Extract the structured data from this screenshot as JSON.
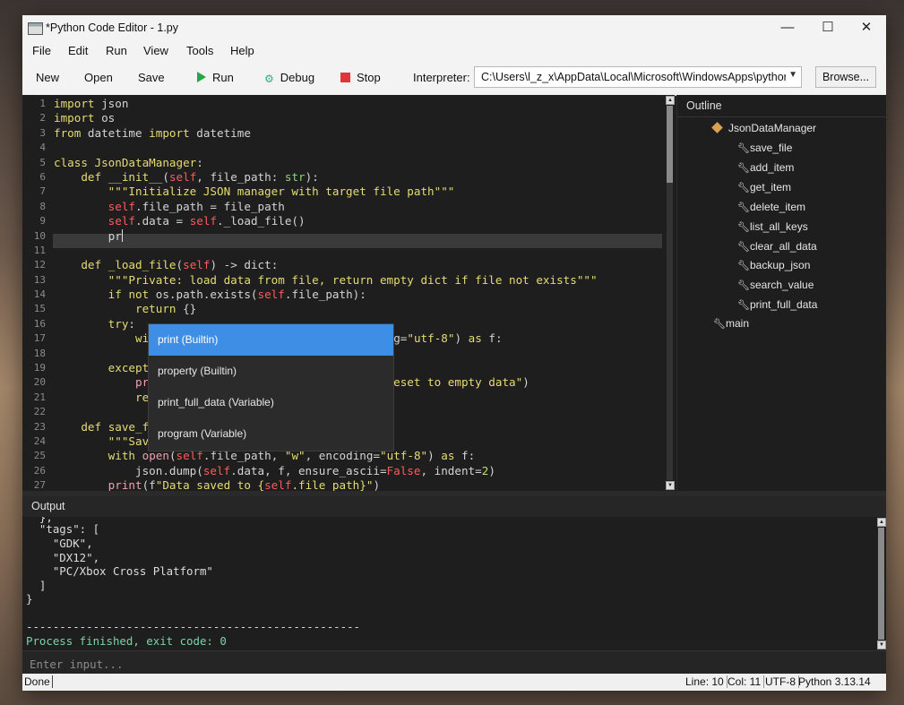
{
  "window": {
    "title": "*Python Code Editor - 1.py",
    "controls": {
      "minimize": "—",
      "maximize": "☐",
      "close": "✕"
    }
  },
  "menu": [
    "File",
    "Edit",
    "Run",
    "View",
    "Tools",
    "Help"
  ],
  "toolbar": {
    "new": "New",
    "open": "Open",
    "save": "Save",
    "run": "Run",
    "debug": "Debug",
    "stop": "Stop",
    "interpreter_label": "Interpreter:",
    "interpreter_value": "C:\\Users\\l_z_x\\AppData\\Local\\Microsoft\\WindowsApps\\python.e",
    "browse": "Browse..."
  },
  "editor": {
    "line_numbers": [
      "1",
      "2",
      "3",
      "4",
      "5",
      "6",
      "7",
      "8",
      "9",
      "10",
      "11",
      "12",
      "13",
      "14",
      "15",
      "16",
      "17",
      "18",
      "19",
      "20",
      "21",
      "22",
      "23",
      "24",
      "25",
      "26",
      "27"
    ],
    "current_line": 10,
    "current_col": 11
  },
  "completion": {
    "selected_index": 0,
    "items": [
      "print (Builtin)",
      "property (Builtin)",
      "print_full_data (Variable)",
      "program (Variable)"
    ]
  },
  "outline": {
    "title": "Outline",
    "class_name": "JsonDataManager",
    "methods": [
      "save_file",
      "add_item",
      "get_item",
      "delete_item",
      "list_all_keys",
      "clear_all_data",
      "backup_json",
      "search_value",
      "print_full_data"
    ],
    "functions": [
      "main"
    ]
  },
  "output": {
    "title": "Output",
    "lines": [
      "  },",
      "  \"tags\": [",
      "    \"GDK\",",
      "    \"DX12\",",
      "    \"PC/Xbox Cross Platform\"",
      "  ]",
      "}",
      "",
      "--------------------------------------------------",
      "Process finished, exit code: 0"
    ],
    "input_placeholder": "Enter input..."
  },
  "status": {
    "message": "Done",
    "line": "Line: 10",
    "col": "Col: 11",
    "encoding": "UTF-8",
    "python": "Python 3.13.14"
  },
  "colors": {
    "accent": "#3e8ee5",
    "run_icon": "#22a646",
    "stop_icon": "#e2353b",
    "keyword": "#e6db74",
    "self": "#ff5a5a"
  }
}
